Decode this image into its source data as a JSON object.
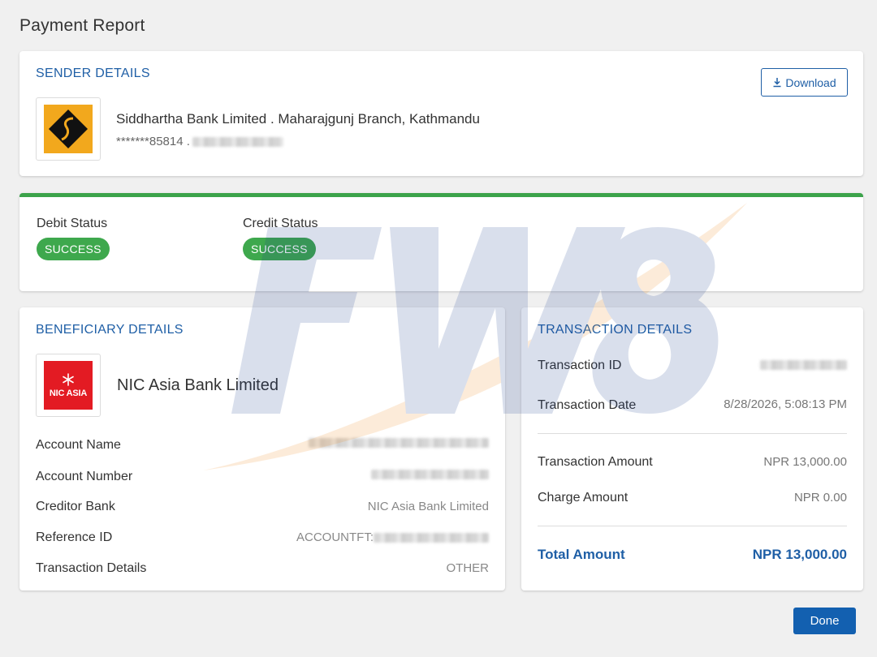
{
  "page": {
    "title": "Payment Report"
  },
  "sender": {
    "section_title": "SENDER DETAILS",
    "download_label": "Download",
    "bank_name": "Siddhartha Bank Limited . Maharajgunj Branch, Kathmandu",
    "account_masked": "*******85814 ."
  },
  "status": {
    "debit_label": "Debit Status",
    "debit_value": "SUCCESS",
    "credit_label": "Credit Status",
    "credit_value": "SUCCESS",
    "success_color": "#3ea84d"
  },
  "beneficiary": {
    "section_title": "BENEFICIARY DETAILS",
    "bank_name": "NIC Asia Bank Limited",
    "logo_text": "NIC ASIA",
    "rows": [
      {
        "label": "Account Name",
        "value": ""
      },
      {
        "label": "Account Number",
        "value": ""
      },
      {
        "label": "Creditor Bank",
        "value": "NIC Asia Bank Limited"
      },
      {
        "label": "Reference ID",
        "value": "ACCOUNTFT:"
      },
      {
        "label": "Transaction Details",
        "value": "OTHER"
      }
    ]
  },
  "transaction": {
    "section_title": "TRANSACTION DETAILS",
    "id_label": "Transaction ID",
    "date_label": "Transaction Date",
    "date_value": "8/28/2026, 5:08:13 PM",
    "amount_label": "Transaction Amount",
    "amount_value": "NPR 13,000.00",
    "charge_label": "Charge Amount",
    "charge_value": "NPR 0.00",
    "total_label": "Total Amount",
    "total_value": "NPR 13,000.00"
  },
  "actions": {
    "done_label": "Done"
  },
  "colors": {
    "accent": "#1f5fa6",
    "primary_button": "#1360b0",
    "status_bar": "#3ca34a"
  }
}
